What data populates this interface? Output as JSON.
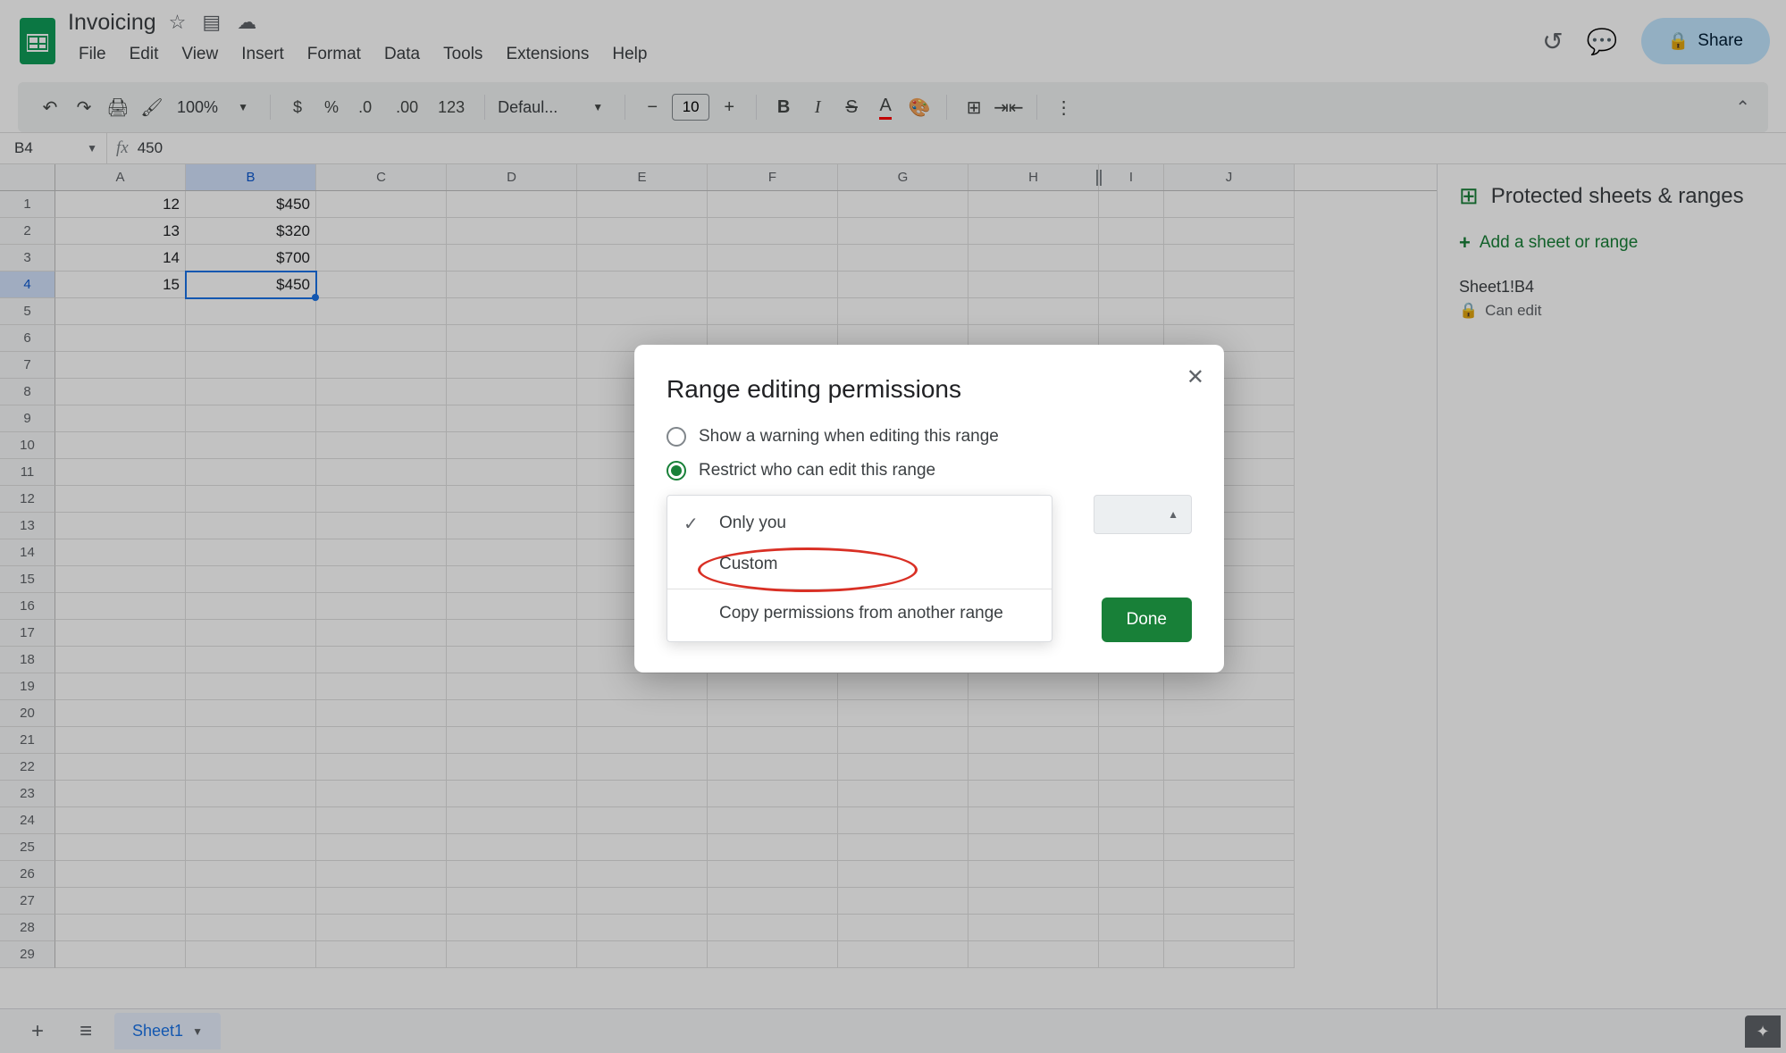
{
  "header": {
    "doc_title": "Invoicing",
    "menus": [
      "File",
      "Edit",
      "View",
      "Insert",
      "Format",
      "Data",
      "Tools",
      "Extensions",
      "Help"
    ],
    "share_label": "Share"
  },
  "toolbar": {
    "zoom": "100%",
    "font": "Defaul...",
    "font_size": "10",
    "number_fmt": "123"
  },
  "formula_bar": {
    "cell_ref": "B4",
    "fx_label": "fx",
    "value": "450"
  },
  "grid": {
    "columns": [
      "A",
      "B",
      "C",
      "D",
      "E",
      "F",
      "G",
      "H",
      "I",
      "J"
    ],
    "selected_col_index": 1,
    "selected_row_index": 3,
    "row_count": 29,
    "data_rows": [
      {
        "a": "12",
        "b": "$450"
      },
      {
        "a": "13",
        "b": "$320"
      },
      {
        "a": "14",
        "b": "$700"
      },
      {
        "a": "15",
        "b": "$450"
      }
    ]
  },
  "sidebar": {
    "title": "Protected sheets & ranges",
    "add_label": "Add a sheet or range",
    "range_name": "Sheet1!B4",
    "perm_label": "Can edit"
  },
  "tabs": {
    "sheet1": "Sheet1"
  },
  "dialog": {
    "title": "Range editing permissions",
    "opt_warn": "Show a warning when editing this range",
    "opt_restrict": "Restrict who can edit this range",
    "dd_only_you": "Only you",
    "dd_custom": "Custom",
    "dd_copy": "Copy permissions from another range",
    "done": "Done"
  }
}
